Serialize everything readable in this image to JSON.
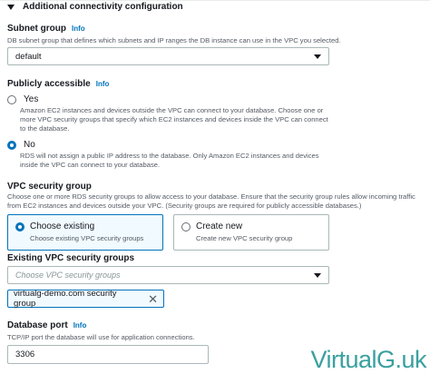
{
  "section": {
    "title": "Additional connectivity configuration"
  },
  "subnet_group": {
    "label": "Subnet group",
    "info": "Info",
    "description": "DB subnet group that defines which subnets and IP ranges the DB instance can use in the VPC you selected.",
    "value": "default"
  },
  "publicly_accessible": {
    "label": "Publicly accessible",
    "info": "Info",
    "options": [
      {
        "label": "Yes",
        "selected": false,
        "description": "Amazon EC2 instances and devices outside the VPC can connect to your database. Choose one or more VPC security groups that specify which EC2 instances and devices inside the VPC can connect to the database."
      },
      {
        "label": "No",
        "selected": true,
        "description": "RDS will not assign a public IP address to the database. Only Amazon EC2 instances and devices inside the VPC can connect to your database."
      }
    ]
  },
  "vpc_security_group": {
    "label": "VPC security group",
    "description": "Choose one or more RDS security groups to allow access to your database. Ensure that the security group rules allow incoming traffic from EC2 instances and devices outside your VPC. (Security groups are required for publicly accessible databases.)",
    "tiles": [
      {
        "title": "Choose existing",
        "description": "Choose existing VPC security groups",
        "selected": true
      },
      {
        "title": "Create new",
        "description": "Create new VPC security group",
        "selected": false
      }
    ]
  },
  "existing_groups": {
    "label": "Existing VPC security groups",
    "placeholder": "Choose VPC security groups",
    "tokens": [
      "virtualg-demo.com security group"
    ]
  },
  "database_port": {
    "label": "Database port",
    "info": "Info",
    "description": "TCP/IP port the database will use for application connections.",
    "value": "3306"
  },
  "watermark": {
    "text": "VirtualG.uk"
  },
  "colors": {
    "accent": "#0073bb",
    "selected_tile_bg": "#f1faff",
    "watermark": "#3aa0a0"
  }
}
